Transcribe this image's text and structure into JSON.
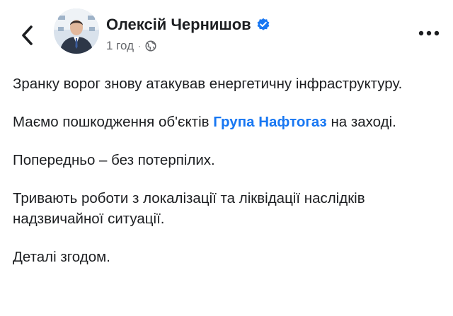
{
  "header": {
    "author_name": "Олексій Чернишов",
    "timestamp": "1 год",
    "separator": "·",
    "back_icon": "chevron-left-icon",
    "more_icon": "more-horizontal-icon",
    "verified_icon": "verified-badge-icon",
    "audience_icon": "globe-icon"
  },
  "post": {
    "p1": "Зранку ворог знову атакував енергетичну інфраструктуру.",
    "p2_before": "Маємо пошкодження об'єктів ",
    "p2_link": "Група Нафтогаз",
    "p2_after": " на заході.",
    "p3": "Попередньо – без потерпілих.",
    "p4": "Тривають роботи з локалізації та ліквідації наслідків надзвичайної ситуації.",
    "p5": "Деталі згодом."
  },
  "colors": {
    "link": "#1877f2",
    "verified": "#1877f2",
    "secondary_text": "#65676b",
    "text": "#1c1e21"
  }
}
